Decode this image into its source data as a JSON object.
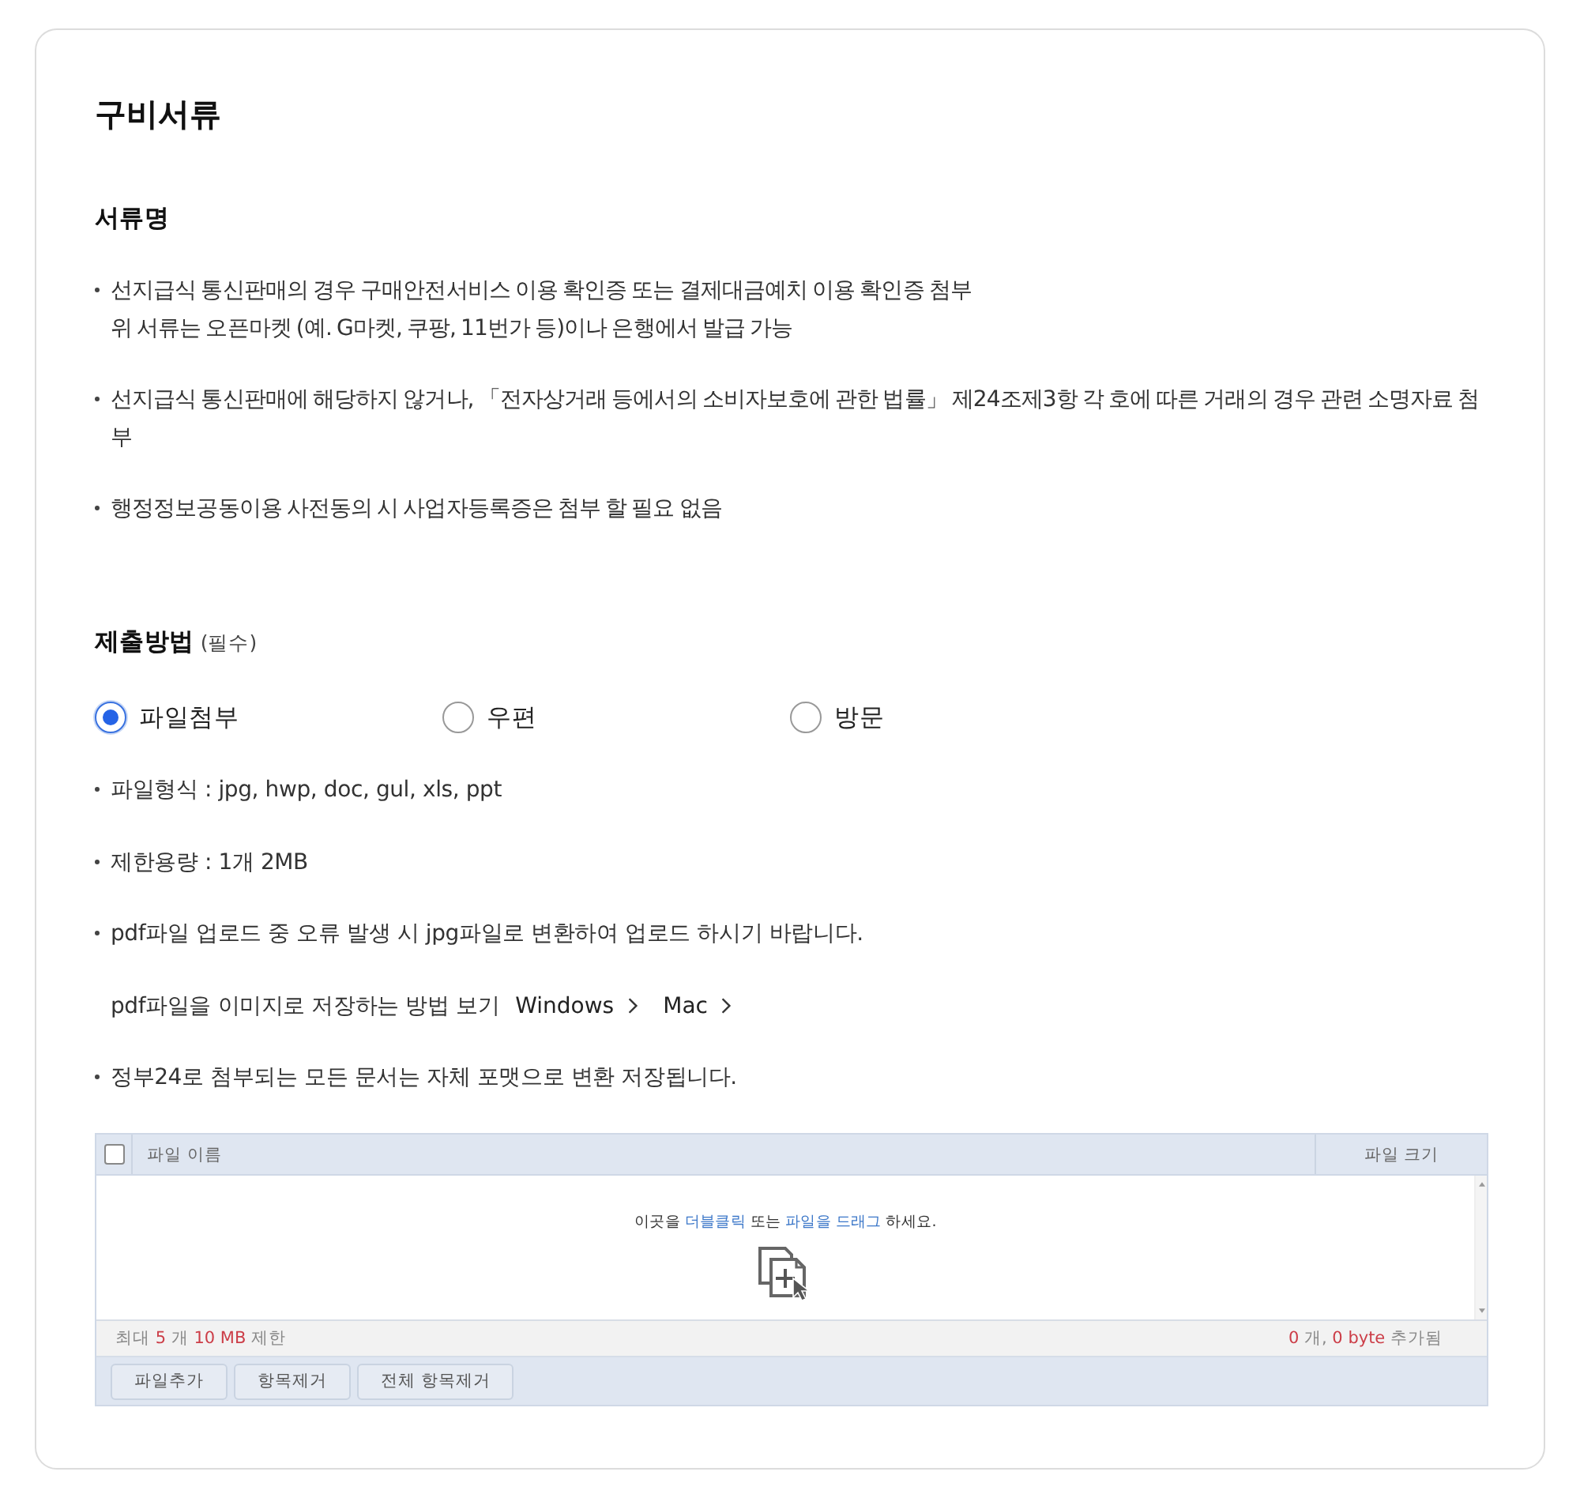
{
  "section": {
    "title": "구비서류"
  },
  "documents": {
    "heading": "서류명",
    "items": [
      {
        "lines": [
          "선지급식 통신판매의 경우 구매안전서비스 이용 확인증 또는 결제대금예치 이용 확인증 첨부",
          "위 서류는 오픈마켓 (예. G마켓, 쿠팡, 11번가 등)이나 은행에서 발급 가능"
        ]
      },
      {
        "lines": [
          "선지급식 통신판매에 해당하지 않거나, 「전자상거래 등에서의 소비자보호에 관한 법률」 제24조제3항 각 호에 따른 거래의 경우 관련 소명자료 첨부"
        ]
      },
      {
        "lines": [
          "행정정보공동이용 사전동의 시 사업자등록증은 첨부 할 필요 없음"
        ]
      }
    ]
  },
  "submission": {
    "heading": "제출방법",
    "note": "(필수)",
    "options": [
      {
        "label": "파일첨부",
        "selected": true
      },
      {
        "label": "우편",
        "selected": false
      },
      {
        "label": "방문",
        "selected": false
      }
    ],
    "notes": [
      {
        "kind": "bullet",
        "text": "파일형식 : jpg, hwp, doc, gul, xls, ppt"
      },
      {
        "kind": "bullet",
        "text": "제한용량 : 1개 2MB"
      },
      {
        "kind": "bullet",
        "text": "pdf파일 업로드 중 오류 발생 시 jpg파일로 변환하여 업로드 하시기 바랍니다."
      },
      {
        "kind": "links",
        "text": "pdf파일을 이미지로 저장하는 방법 보기",
        "links": [
          {
            "label": "Windows"
          },
          {
            "label": "Mac"
          }
        ]
      },
      {
        "kind": "bullet",
        "text": "정부24로 첨부되는 모든 문서는 자체 포맷으로 변환 저장됩니다."
      }
    ]
  },
  "uploader": {
    "select_all": {
      "checked": false
    },
    "columns": [
      "파일 이름",
      "파일 크기"
    ],
    "hint": [
      {
        "text": "이곳을",
        "highlight": false
      },
      {
        "text": "더블클릭",
        "highlight": true
      },
      {
        "text": "또는",
        "highlight": false
      },
      {
        "text": "파일을 드래그",
        "highlight": true
      },
      {
        "text": "하세요.",
        "highlight": false
      }
    ],
    "limit": [
      {
        "text": "최대",
        "highlight": false
      },
      {
        "text": "5",
        "highlight": true
      },
      {
        "text": "개",
        "highlight": false
      },
      {
        "text": "10 MB",
        "highlight": true
      },
      {
        "text": "제한",
        "highlight": false
      }
    ],
    "total": [
      {
        "text": "0",
        "highlight": true
      },
      {
        "text": "개,",
        "highlight": false
      },
      {
        "text": "0 byte",
        "highlight": true
      },
      {
        "text": "추가됨",
        "highlight": false
      }
    ],
    "buttons": [
      "파일추가",
      "항목제거",
      "전체 항목제거"
    ]
  }
}
